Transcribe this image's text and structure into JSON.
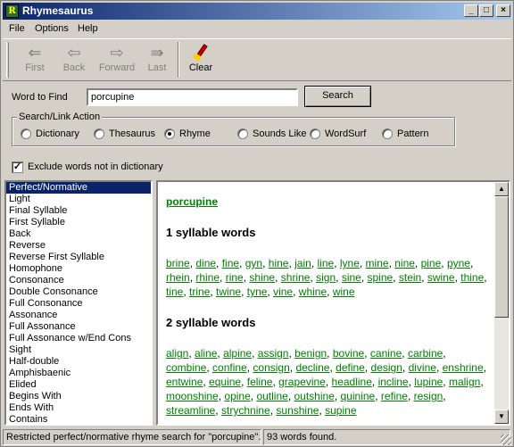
{
  "window": {
    "title": "Rhymesaurus",
    "app_icon": "R"
  },
  "menu": {
    "file": "File",
    "options": "Options",
    "help": "Help"
  },
  "toolbar": {
    "first": "First",
    "back": "Back",
    "forward": "Forward",
    "last": "Last",
    "clear": "Clear"
  },
  "form": {
    "word_label": "Word to Find",
    "word_value": "porcupine",
    "search_label": "Search",
    "group_label": "Search/Link Action",
    "options": {
      "dictionary": "Dictionary",
      "thesaurus": "Thesaurus",
      "rhyme": "Rhyme",
      "sounds_like": "Sounds Like",
      "wordsurf": "WordSurf",
      "pattern": "Pattern"
    },
    "selected_option": "Rhyme",
    "exclude_label": "Exclude words not in dictionary",
    "exclude_checked": true
  },
  "rhyme_types": [
    "Perfect/Normative",
    "Light",
    "Final Syllable",
    "First Syllable",
    "Back",
    "Reverse",
    "Reverse First Syllable",
    "Homophone",
    "Consonance",
    "Double Consonance",
    "Full Consonance",
    "Assonance",
    "Full Assonance",
    "Full Assonance w/End Cons",
    "Sight",
    "Half-double",
    "Amphisbaenic",
    "Elided",
    "Begins With",
    "Ends With",
    "Contains"
  ],
  "results": {
    "word": "porcupine",
    "groups": [
      {
        "heading": "1 syllable words",
        "words": [
          "brine",
          "dine",
          "fine",
          "gyn",
          "hine",
          "jain",
          "line",
          "lyne",
          "mine",
          "nine",
          "pine",
          "pyne",
          "rhein",
          "rhine",
          "rine",
          "shine",
          "shrine",
          "sign",
          "sine",
          "spine",
          "stein",
          "swine",
          "thine",
          "tine",
          "trine",
          "twine",
          "tyne",
          "vine",
          "whine",
          "wine"
        ]
      },
      {
        "heading": "2 syllable words",
        "words": [
          "align",
          "aline",
          "alpine",
          "assign",
          "benign",
          "bovine",
          "canine",
          "carbine",
          "combine",
          "confine",
          "consign",
          "decline",
          "define",
          "design",
          "divine",
          "enshrine",
          "entwine",
          "equine",
          "feline",
          "grapevine",
          "headline",
          "incline",
          "lupine",
          "malign",
          "moonshine",
          "opine",
          "outline",
          "outshine",
          "quinine",
          "refine",
          "resign",
          "streamline",
          "strychnine",
          "sunshine",
          "supine"
        ]
      }
    ]
  },
  "status": {
    "message": "Restricted perfect/normative rhyme search for \"porcupine\".",
    "count": "93 words found."
  }
}
